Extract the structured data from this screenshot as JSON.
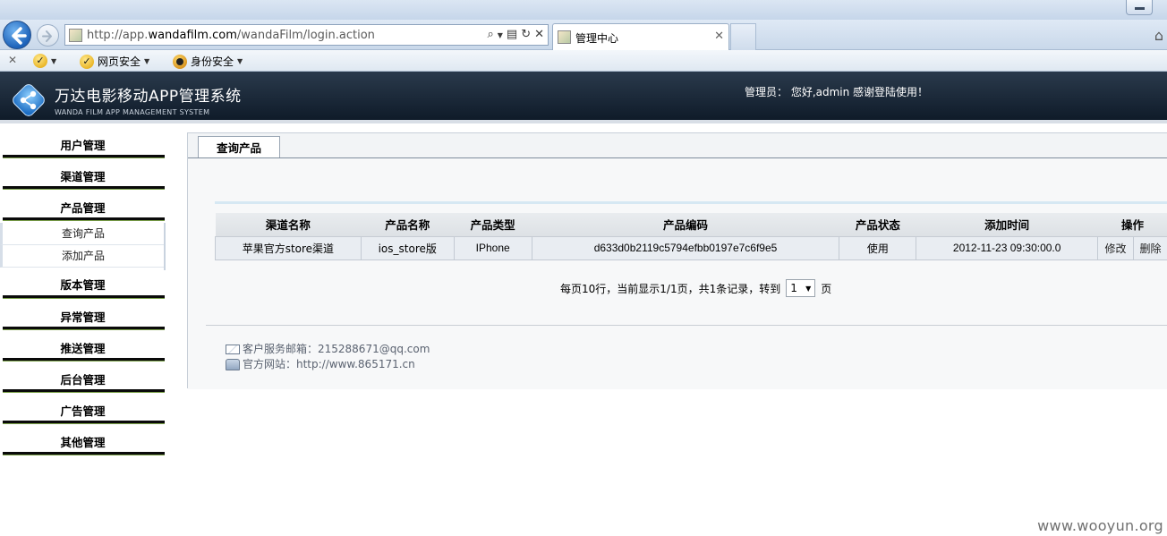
{
  "browser": {
    "address_url_prefix": "http://app.",
    "address_url_domain": "wandafilm.com",
    "address_url_path": "/wandaFilm/login.action",
    "tab_title": "管理中心",
    "cmdbar": {
      "web_security": "网页安全",
      "identity_security": "身份安全"
    }
  },
  "header": {
    "title": "万达电影移动APP管理系统",
    "subtitle": "WANDA FILM APP MANAGEMENT SYSTEM",
    "welcome": "管理员：  您好,admin 感谢登陆使用！"
  },
  "sidebar": {
    "groups_before": [
      "用户管理",
      "渠道管理",
      "产品管理"
    ],
    "submenu": [
      "查询产品",
      "添加产品"
    ],
    "groups_after": [
      "版本管理",
      "异常管理",
      "推送管理",
      "后台管理",
      "广告管理",
      "其他管理"
    ]
  },
  "panel": {
    "tab": "查询产品",
    "table": {
      "headers": [
        "渠道名称",
        "产品名称",
        "产品类型",
        "产品编码",
        "产品状态",
        "添加时间",
        "操作"
      ],
      "rows": [
        {
          "channel": "苹果官方store渠道",
          "product_name": "ios_store版",
          "product_type": "IPhone",
          "product_code": "d633d0b2119c5794efbb0197e7c6f9e5",
          "status": "使用",
          "added_time": "2012-11-23 09:30:00.0",
          "edit": "修改",
          "delete": "删除"
        }
      ]
    },
    "pager": {
      "text": "每页10行，当前显示1/1页，共1条记录，转到",
      "page": "1",
      "suffix": "页"
    },
    "contact": {
      "email": "客户服务邮箱：215288671@qq.com",
      "website": "官方网站：http://www.865171.cn"
    }
  },
  "watermark": "www.wooyun.org",
  "colors": {
    "header_bg": "#15212f",
    "sidebar_bar": "#0a0a0a",
    "table_row": "#e9edf2"
  }
}
